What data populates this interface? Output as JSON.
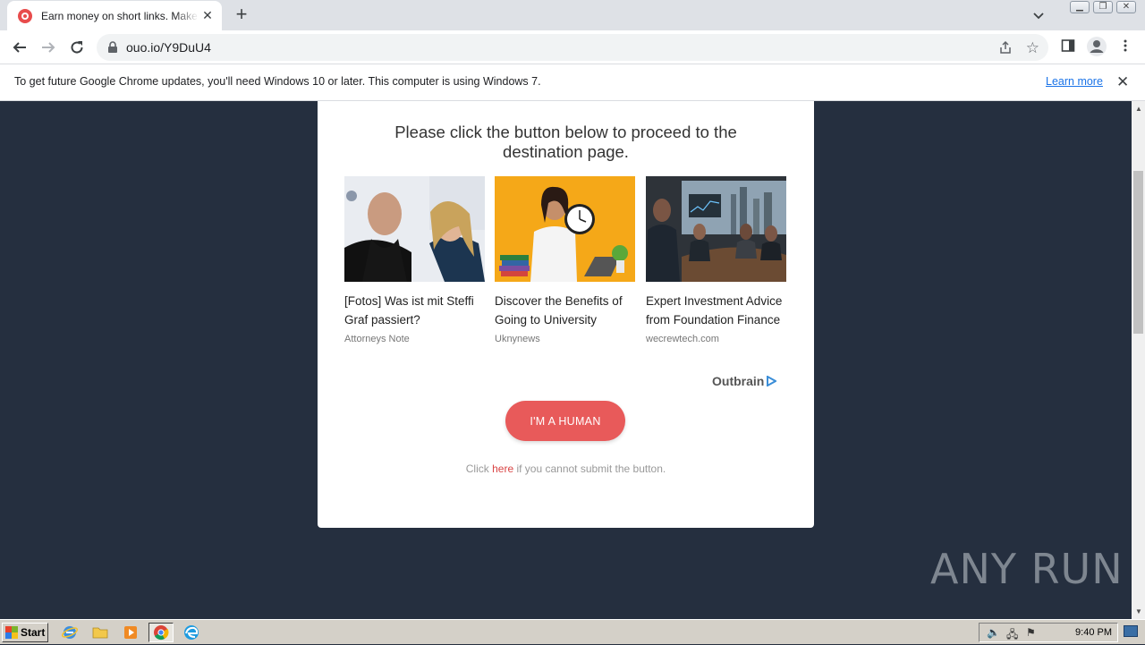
{
  "browser": {
    "tab": {
      "title": "Earn money on short links. Make short links and earn"
    },
    "address": {
      "url": "ouo.io/Y9DuU4"
    },
    "infobar": {
      "message": "To get future Google Chrome updates, you'll need Windows 10 or later. This computer is using Windows 7.",
      "link": "Learn more"
    }
  },
  "page": {
    "heading": "Please click the button below to proceed to the destination page.",
    "ads": [
      {
        "title": "[Fotos] Was ist mit Steffi Graf passiert?",
        "source": "Attorneys Note"
      },
      {
        "title": "Discover the Benefits of Going to University",
        "source": "Uknynews"
      },
      {
        "title": "Expert Investment Advice from Foundation Finance",
        "source": "wecrewtech.com"
      }
    ],
    "ad_provider": "Outbrain",
    "human_button": "I'M A HUMAN",
    "fallback": {
      "prefix": "Click ",
      "link": "here",
      "suffix": " if you cannot submit the button."
    }
  },
  "watermark": "ANY RUN",
  "taskbar": {
    "start": "Start",
    "time": "9:40 PM"
  },
  "colors": {
    "page_bg": "#252f3f",
    "button": "#e85a5a",
    "link": "#d94545"
  }
}
